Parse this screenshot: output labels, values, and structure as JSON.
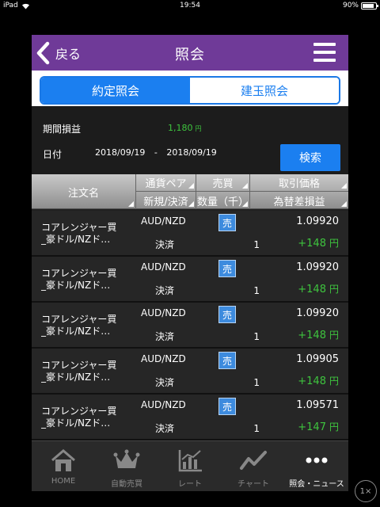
{
  "statusbar": {
    "device": "iPad",
    "time": "19:54",
    "battery": "90%",
    "battery_level": 0.9
  },
  "nav": {
    "back_label": "戻る",
    "title": "照会"
  },
  "segments": [
    {
      "label": "約定照会",
      "active": true
    },
    {
      "label": "建玉照会",
      "active": false
    }
  ],
  "summary": {
    "period_pl_label": "期間損益",
    "period_pl_value": "1,180",
    "period_pl_unit": "円",
    "date_label": "日付",
    "date_from": "2018/09/19",
    "date_sep": "-",
    "date_to": "2018/09/19",
    "search_label": "検索"
  },
  "table": {
    "headers": {
      "name": "注文名",
      "pair": "通貨ペア",
      "new_close": "新規/決済",
      "side": "売買",
      "qty": "数量（千）",
      "price": "取引価格",
      "pl": "為替差損益"
    },
    "rows": [
      {
        "name1": "コアレンジャー買",
        "name2": "_豪ドル/NZド…",
        "pair": "AUD/NZD",
        "side": "売",
        "kind": "決済",
        "qty": "1",
        "price": "1.09920",
        "pl": "+148",
        "pl_unit": "円"
      },
      {
        "name1": "コアレンジャー買",
        "name2": "_豪ドル/NZド…",
        "pair": "AUD/NZD",
        "side": "売",
        "kind": "決済",
        "qty": "1",
        "price": "1.09920",
        "pl": "+148",
        "pl_unit": "円"
      },
      {
        "name1": "コアレンジャー買",
        "name2": "_豪ドル/NZド…",
        "pair": "AUD/NZD",
        "side": "売",
        "kind": "決済",
        "qty": "1",
        "price": "1.09920",
        "pl": "+148",
        "pl_unit": "円"
      },
      {
        "name1": "コアレンジャー買",
        "name2": "_豪ドル/NZド…",
        "pair": "AUD/NZD",
        "side": "売",
        "kind": "決済",
        "qty": "1",
        "price": "1.09905",
        "pl": "+148",
        "pl_unit": "円"
      },
      {
        "name1": "コアレンジャー買",
        "name2": "_豪ドル/NZド…",
        "pair": "AUD/NZD",
        "side": "売",
        "kind": "決済",
        "qty": "1",
        "price": "1.09571",
        "pl": "+147",
        "pl_unit": "円"
      }
    ]
  },
  "tabbar": [
    {
      "label": "HOME",
      "icon": "home-icon",
      "active": false
    },
    {
      "label": "自動売買",
      "icon": "crown-icon",
      "active": false
    },
    {
      "label": "レート",
      "icon": "rate-chart-icon",
      "active": false
    },
    {
      "label": "チャート",
      "icon": "line-chart-icon",
      "active": false
    },
    {
      "label": "照会・ニュース",
      "icon": "more-dots-icon",
      "active": true
    }
  ],
  "zoom": {
    "label": "1×"
  },
  "colors": {
    "header": "#6f3a98",
    "accent": "#1b7ff0",
    "positive": "#3ec43e"
  }
}
